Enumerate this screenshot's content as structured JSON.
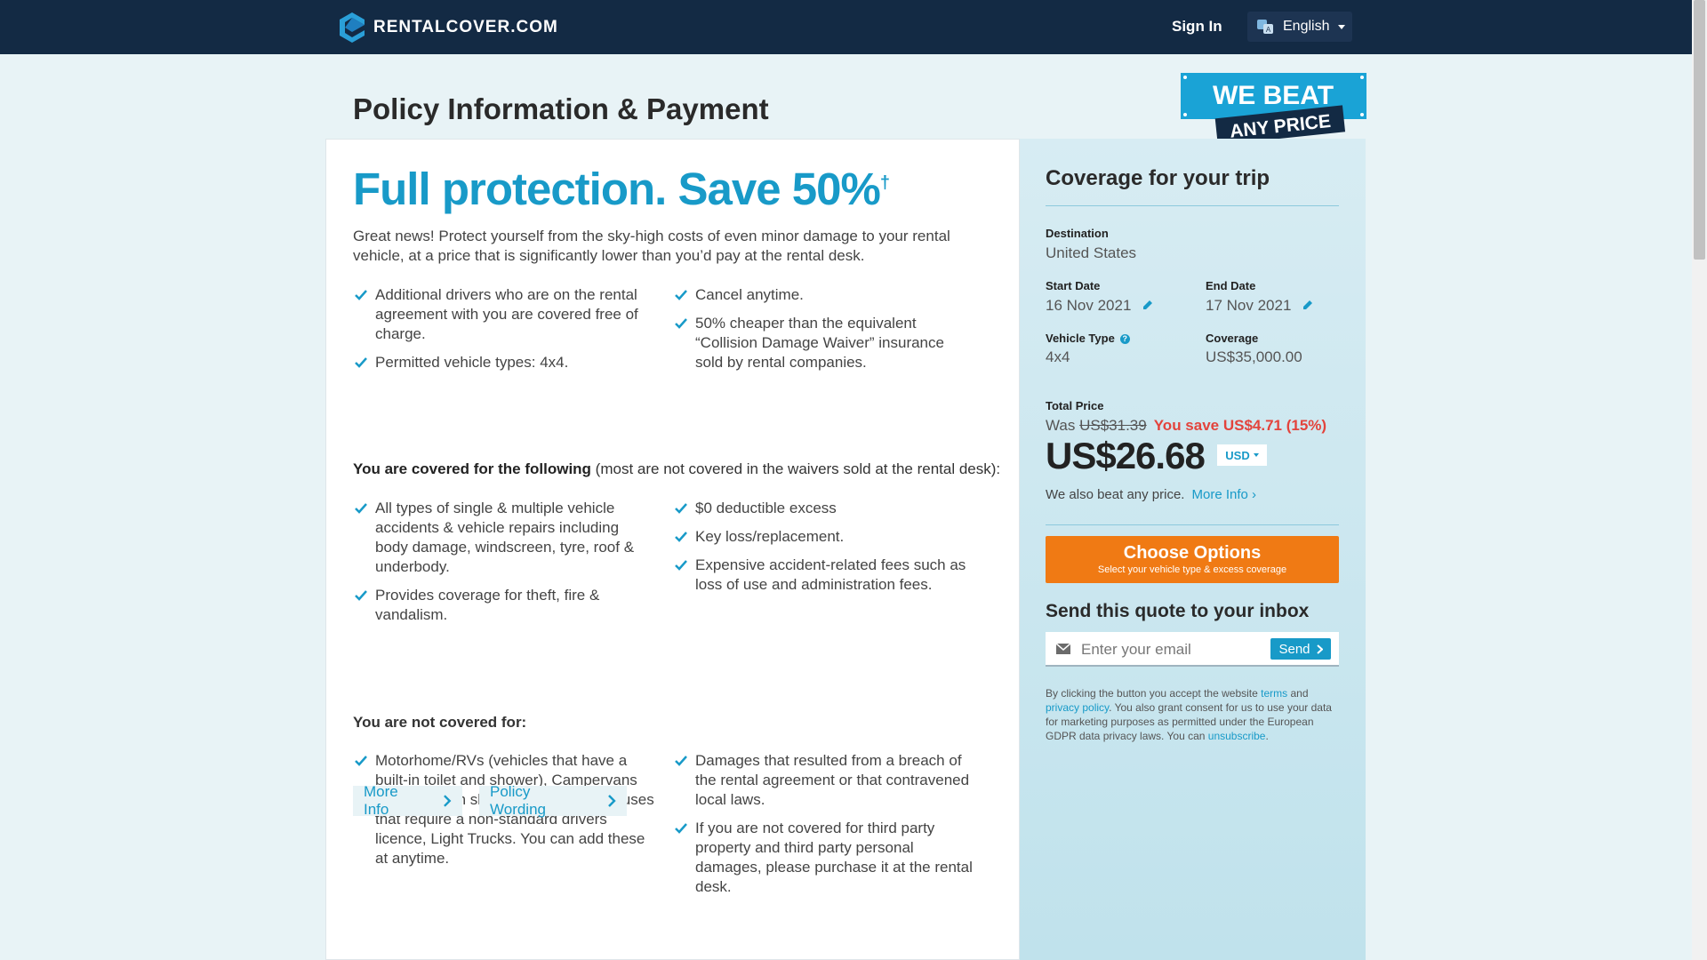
{
  "nav": {
    "brand": "RENTALCOVER.COM",
    "sign_in": "Sign In",
    "language": "English"
  },
  "page": {
    "title": "Policy Information & Payment",
    "badge_line1": "WE BEAT",
    "badge_line2": "ANY PRICE"
  },
  "main": {
    "headline": "Full protection. Save 50%",
    "headline_mark": "†",
    "intro": "Great news! Protect yourself from the sky-high costs of even minor damage to your rental vehicle, at a price that is significantly lower than you’d pay at the rental desk.",
    "features_left": [
      "Additional drivers who are on the rental agreement with you are covered free of charge.",
      "Permitted vehicle types: 4x4."
    ],
    "features_right": [
      "Cancel anytime.",
      "50% cheaper than the equivalent “Collision Damage Waiver” insurance sold by rental companies."
    ],
    "covered_head_bold": "You are covered for the following",
    "covered_head_rest": " (most are not covered in the waivers sold at the rental desk):",
    "covered_left": [
      "All types of single & multiple vehicle accidents & vehicle repairs including body damage, windscreen, tyre, roof & underbody.",
      "Provides coverage for theft, fire & vandalism."
    ],
    "covered_right": [
      "$0 deductible excess",
      "Key loss/replacement.",
      "Expensive accident-related fees such as loss of use and administration fees."
    ],
    "not_covered_head": "You are not covered for:",
    "not_covered_left": [
      "Motorhome/RVs (vehicles that have a built-in toilet and shower), Campervans (vehicles with sleeping berths), Minibuses that require a non-standard drivers licence, Light Trucks. You can add these at anytime."
    ],
    "not_covered_right": [
      "Damages that resulted from a breach of the rental agreement or that contravened local laws.",
      "If you are not covered for third party property and third party personal damages, please purchase it at the rental desk."
    ],
    "more_info_btn": "More Info",
    "policy_wording_btn": "Policy Wording"
  },
  "side": {
    "title": "Coverage for your trip",
    "destination_label": "Destination",
    "destination": "United States",
    "start_label": "Start Date",
    "start_date": "16 Nov 2021",
    "end_label": "End Date",
    "end_date": "17 Nov 2021",
    "vehicle_label": "Vehicle Type",
    "vehicle": "4x4",
    "coverage_label": "Coverage",
    "coverage": "US$35,000.00",
    "total_label": "Total Price",
    "was_label": "Was",
    "was_price": "US$31.39",
    "you_save": "You save US$4.71 (15%)",
    "price": "US$26.68",
    "currency": "USD",
    "beat_text": "We also beat any price.",
    "beat_link": "More Info ›",
    "choose_title": "Choose Options",
    "choose_sub": "Select your vehicle type & excess coverage",
    "send_title": "Send this quote to your inbox",
    "email_placeholder": "Enter your email",
    "send_btn": "Send",
    "legal_1": "By clicking the button you accept the website ",
    "legal_terms": "terms",
    "legal_2": " and ",
    "legal_privacy": "privacy policy",
    "legal_3": ". You also grant consent for us to use your data for marketing purposes as permitted under the European GDPR data privacy laws. You can ",
    "legal_unsub": "unsubscribe",
    "legal_4": "."
  },
  "colors": {
    "navy": "#132a44",
    "accent": "#189ac8",
    "orange": "#f07a14",
    "save_red": "#e3433c"
  }
}
